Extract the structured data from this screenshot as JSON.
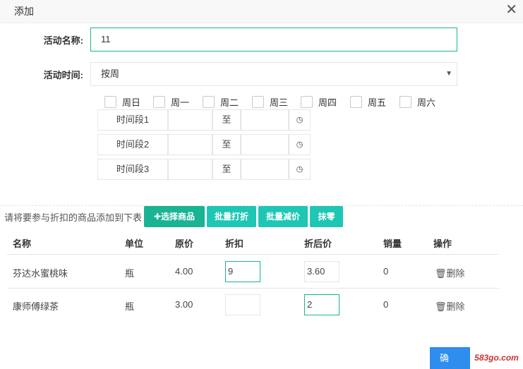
{
  "dialog": {
    "title": "添加"
  },
  "form": {
    "name_label": "活动名称:",
    "name_value": "11",
    "time_label": "活动时间:",
    "time_value": "按周"
  },
  "weekdays": [
    "周日",
    "周一",
    "周二",
    "周三",
    "周四",
    "周五",
    "周六"
  ],
  "time_slots": [
    {
      "label": "时间段1",
      "to": "至"
    },
    {
      "label": "时间段2",
      "to": "至"
    },
    {
      "label": "时间段3",
      "to": "至"
    }
  ],
  "toolbar": {
    "hint": "请将要参与折扣的商品添加到下表",
    "select_goods": "✚选择商品",
    "batch_discount": "批量打折",
    "batch_reduce": "批量减价",
    "round": "抹零"
  },
  "table": {
    "headers": [
      "名称",
      "单位",
      "原价",
      "折扣",
      "折后价",
      "销量",
      "操作"
    ],
    "rows": [
      {
        "name": "芬达水蜜桃味",
        "unit": "瓶",
        "price": "4.00",
        "discount": "9",
        "after": "3.60",
        "sales": "0",
        "action": "删除"
      },
      {
        "name": "康师傅绿茶",
        "unit": "瓶",
        "price": "3.00",
        "discount": "",
        "after": "2",
        "sales": "0",
        "action": "删除"
      }
    ]
  },
  "footer": {
    "confirm": "确",
    "watermark": "583go.com"
  }
}
